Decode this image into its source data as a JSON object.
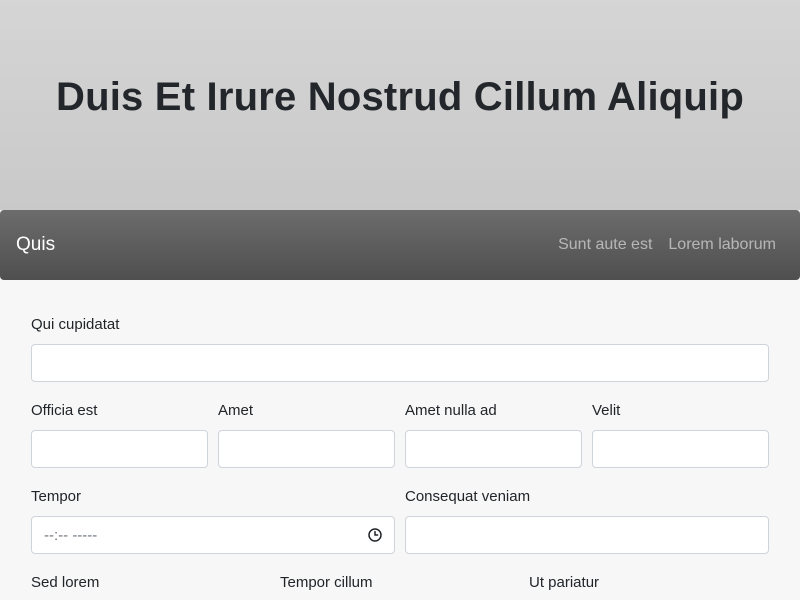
{
  "hero": {
    "title": "Duis Et Irure Nostrud Cillum Aliquip"
  },
  "navbar": {
    "brand": "Quis",
    "links": [
      "Sunt aute est",
      "Lorem laborum"
    ]
  },
  "form": {
    "row1": {
      "label": "Qui cupidatat",
      "value": ""
    },
    "row2": [
      {
        "label": "Officia est",
        "value": ""
      },
      {
        "label": "Amet",
        "value": ""
      },
      {
        "label": "Amet nulla ad",
        "value": ""
      },
      {
        "label": "Velit",
        "value": ""
      }
    ],
    "row3": [
      {
        "label": "Tempor",
        "value": "--:-- -----",
        "icon": "clock-icon"
      },
      {
        "label": "Consequat veniam",
        "value": ""
      }
    ],
    "row4": [
      {
        "label": "Sed lorem"
      },
      {
        "label": "Tempor cillum"
      },
      {
        "label": "Ut pariatur"
      }
    ]
  }
}
